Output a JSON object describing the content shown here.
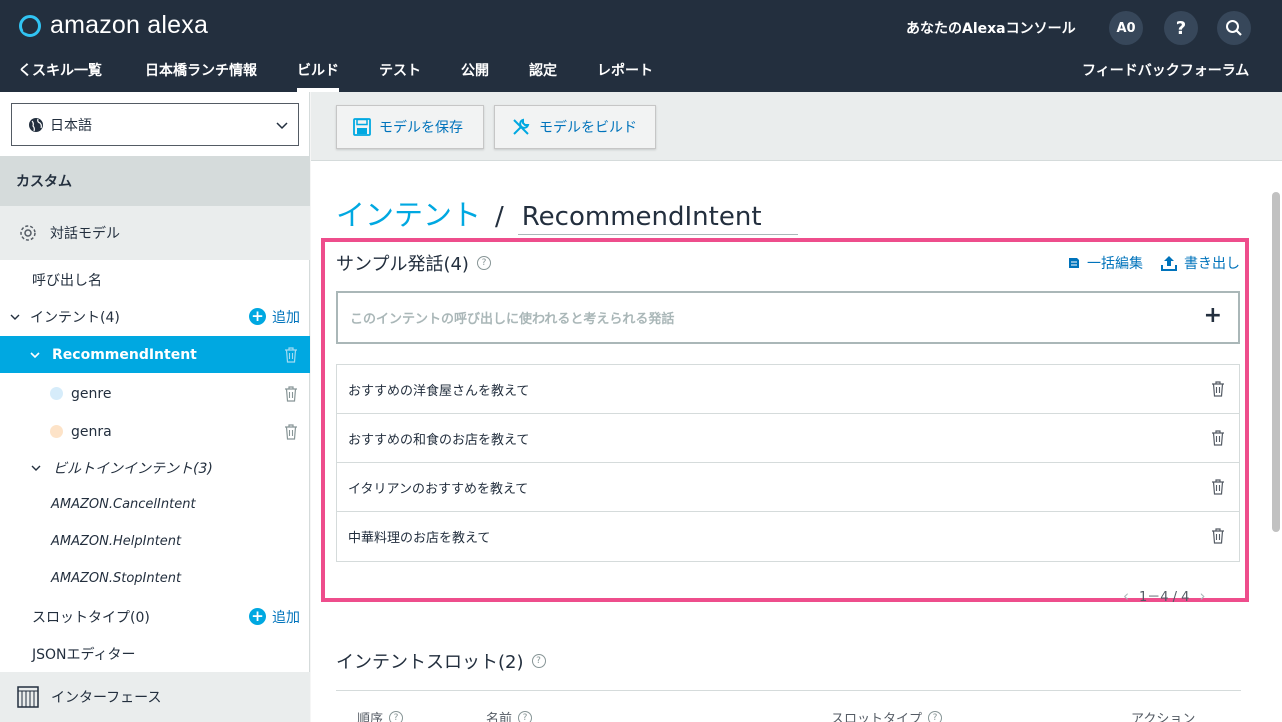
{
  "header": {
    "logo_text": "amazon alexa",
    "console_title": "あなたのAlexaコンソール",
    "avatar_initials": "A0",
    "help_label": "?"
  },
  "nav": {
    "back_label": "くスキル一覧",
    "skill_name": "日本橋ランチ情報",
    "tabs": [
      "ビルド",
      "テスト",
      "公開",
      "認定",
      "レポート"
    ],
    "active_tab": "ビルド",
    "feedback_label": "フィードバックフォーラム"
  },
  "sidebar": {
    "language": "日本語",
    "section_custom": "カスタム",
    "interaction_model": "対話モデル",
    "invocation": "呼び出し名",
    "intents_label": "インテント(4)",
    "add_label": "追加",
    "selected_intent": "RecommendIntent",
    "slots": [
      {
        "name": "genre",
        "color": "#d6ecfa"
      },
      {
        "name": "genra",
        "color": "#fde3c8"
      }
    ],
    "builtin_label": "ビルトインインテント(3)",
    "builtin_intents": [
      "AMAZON.CancelIntent",
      "AMAZON.HelpIntent",
      "AMAZON.StopIntent"
    ],
    "slot_types_label": "スロットタイプ(0)",
    "json_editor": "JSONエディター",
    "interfaces": "インターフェース"
  },
  "toolbar": {
    "save_label": "モデルを保存",
    "build_label": "モデルをビルド"
  },
  "breadcrumb": {
    "parent": "インテント",
    "separator": "/",
    "intent_name": "RecommendIntent"
  },
  "utterances": {
    "title": "サンプル発話(4)",
    "bulk_edit": "一括編集",
    "export": "書き出し",
    "placeholder": "このインテントの呼び出しに使われると考えられる発話",
    "add_symbol": "+",
    "items": [
      "おすすめの洋食屋さんを教えて",
      "おすすめの和食のお店を教えて",
      "イタリアンのおすすめを教えて",
      "中華料理のお店を教えて"
    ],
    "pagination": "1－4 / 4"
  },
  "slots_section": {
    "title": "インテントスロット(2)",
    "columns": [
      "順序",
      "名前",
      "スロットタイプ",
      "アクション"
    ]
  },
  "colors": {
    "header_bg": "#232f3e",
    "accent": "#00a8e1",
    "highlight": "#ee4d8c",
    "link": "#0073bb"
  }
}
